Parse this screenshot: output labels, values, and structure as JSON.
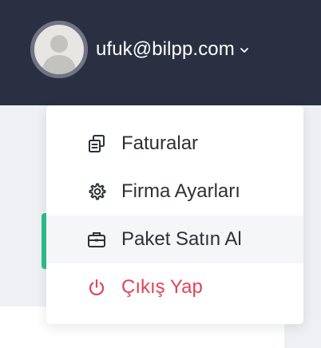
{
  "header": {
    "user_email": "ufuk@bilpp.com"
  },
  "menu": {
    "items": [
      {
        "label": "Faturalar",
        "icon": "documents-icon"
      },
      {
        "label": "Firma Ayarları",
        "icon": "gear-icon"
      },
      {
        "label": "Paket Satın Al",
        "icon": "briefcase-icon"
      },
      {
        "label": "Çıkış Yap",
        "icon": "power-icon"
      }
    ]
  },
  "colors": {
    "topbar": "#2a3042",
    "logout": "#e0435a",
    "accent": "#2dbf8a"
  }
}
